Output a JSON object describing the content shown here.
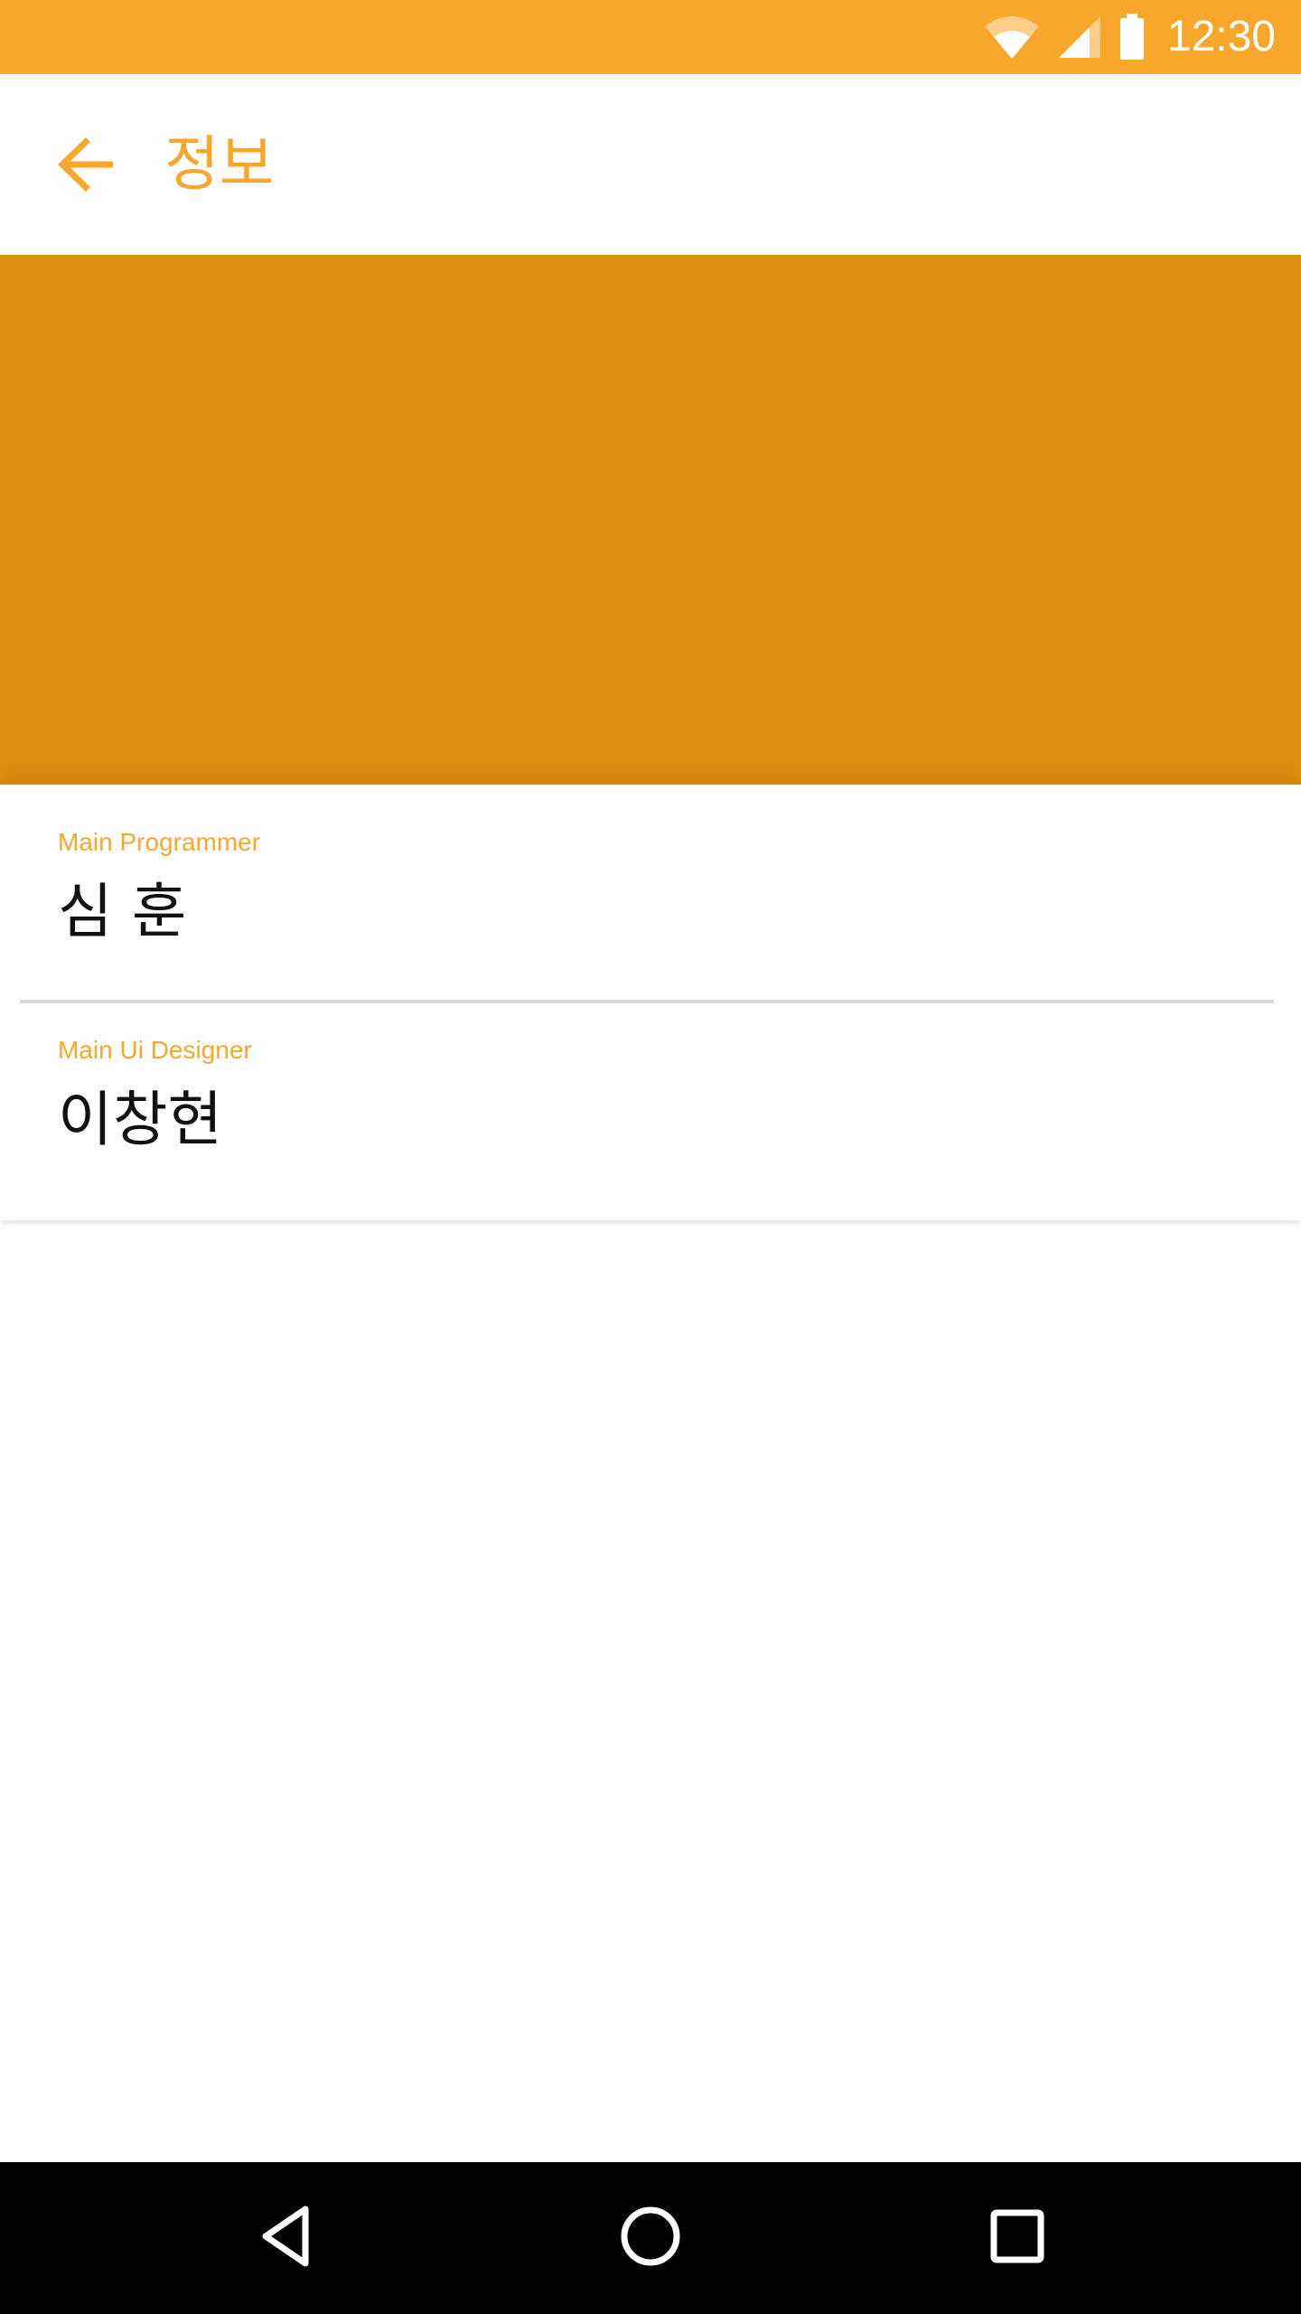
{
  "status_bar": {
    "time": "12:30",
    "icons": [
      "wifi-icon",
      "signal-icon",
      "battery-icon"
    ],
    "background": "#F9A72B"
  },
  "app_bar": {
    "title": "정보",
    "back_icon": "arrow-left-icon",
    "accent": "#F9A72B"
  },
  "hero": {
    "color": "#DE8D0E"
  },
  "credits": [
    {
      "role": "Main Programmer",
      "name": "심 훈"
    },
    {
      "role": "Main Ui Designer",
      "name": "이창현"
    }
  ],
  "nav_bar": {
    "icons": [
      "triangle-back-icon",
      "circle-home-icon",
      "square-recents-icon"
    ]
  }
}
